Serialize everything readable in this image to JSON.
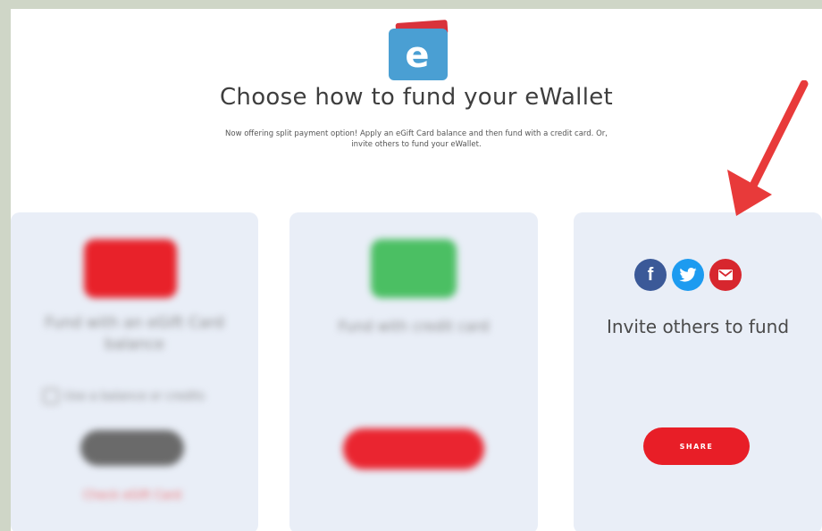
{
  "header": {
    "title": "Choose how to fund your eWallet",
    "subtitle": "Now offering split payment option! Apply an eGift Card balance and then fund with a credit card. Or, invite others to fund your eWallet."
  },
  "cards": [
    {
      "label": "Fund with an eGift Card balance",
      "option_text": "Use a balance or credits",
      "option_highlight": "balance",
      "link": "Check eGift Card"
    },
    {
      "label": "Fund with credit card"
    },
    {
      "label": "Invite others to fund",
      "share_button": "SHARE",
      "social": [
        "facebook-icon",
        "twitter-icon",
        "email-icon"
      ]
    }
  ],
  "colors": {
    "accent_red": "#e81e27",
    "green": "#4bbf63",
    "facebook": "#3b5998",
    "twitter": "#1d9bf0",
    "card_bg": "#e9eef7",
    "arrow": "#e83a3a"
  }
}
